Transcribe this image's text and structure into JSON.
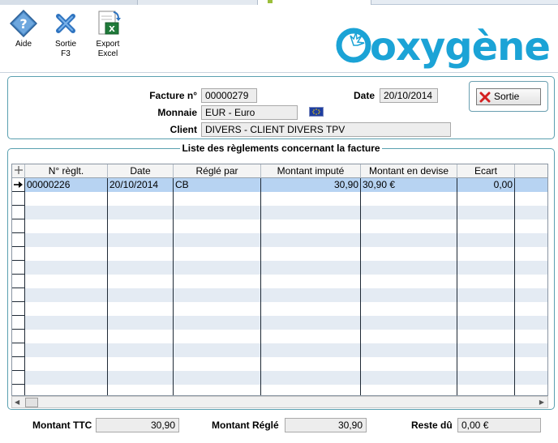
{
  "toolbar": {
    "aide_label": "Aide",
    "sortie_label_1": "Sortie",
    "sortie_label_2": "F3",
    "export_label_1": "Export",
    "export_label_2": "Excel"
  },
  "logo_text": "oxygène",
  "header": {
    "facture_label": "Facture n°",
    "facture_value": "00000279",
    "date_label": "Date",
    "date_value": "20/10/2014",
    "monnaie_label": "Monnaie",
    "monnaie_value": "EUR - Euro",
    "client_label": "Client",
    "client_value": "DIVERS - CLIENT DIVERS TPV",
    "sortie_button": "Sortie"
  },
  "list": {
    "title": "Liste des règlements concernant la facture",
    "columns": [
      "N° règlt.",
      "Date",
      "Réglé par",
      "Montant imputé",
      "Montant en devise",
      "Ecart"
    ],
    "rows": [
      [
        "00000226",
        "20/10/2014",
        "CB",
        "30,90",
        "30,90 €",
        "0,00"
      ]
    ]
  },
  "totals": {
    "ttc_label": "Montant TTC",
    "ttc_value": "30,90",
    "regle_label": "Montant Réglé",
    "regle_value": "30,90",
    "reste_label": "Reste dû",
    "reste_value": "0,00 €"
  },
  "colors": {
    "panel_border": "#5aa0b0",
    "selected_row": "#b7d3f2",
    "alt_row": "#e4ebf3",
    "logo_blue": "#1ba3d6"
  }
}
